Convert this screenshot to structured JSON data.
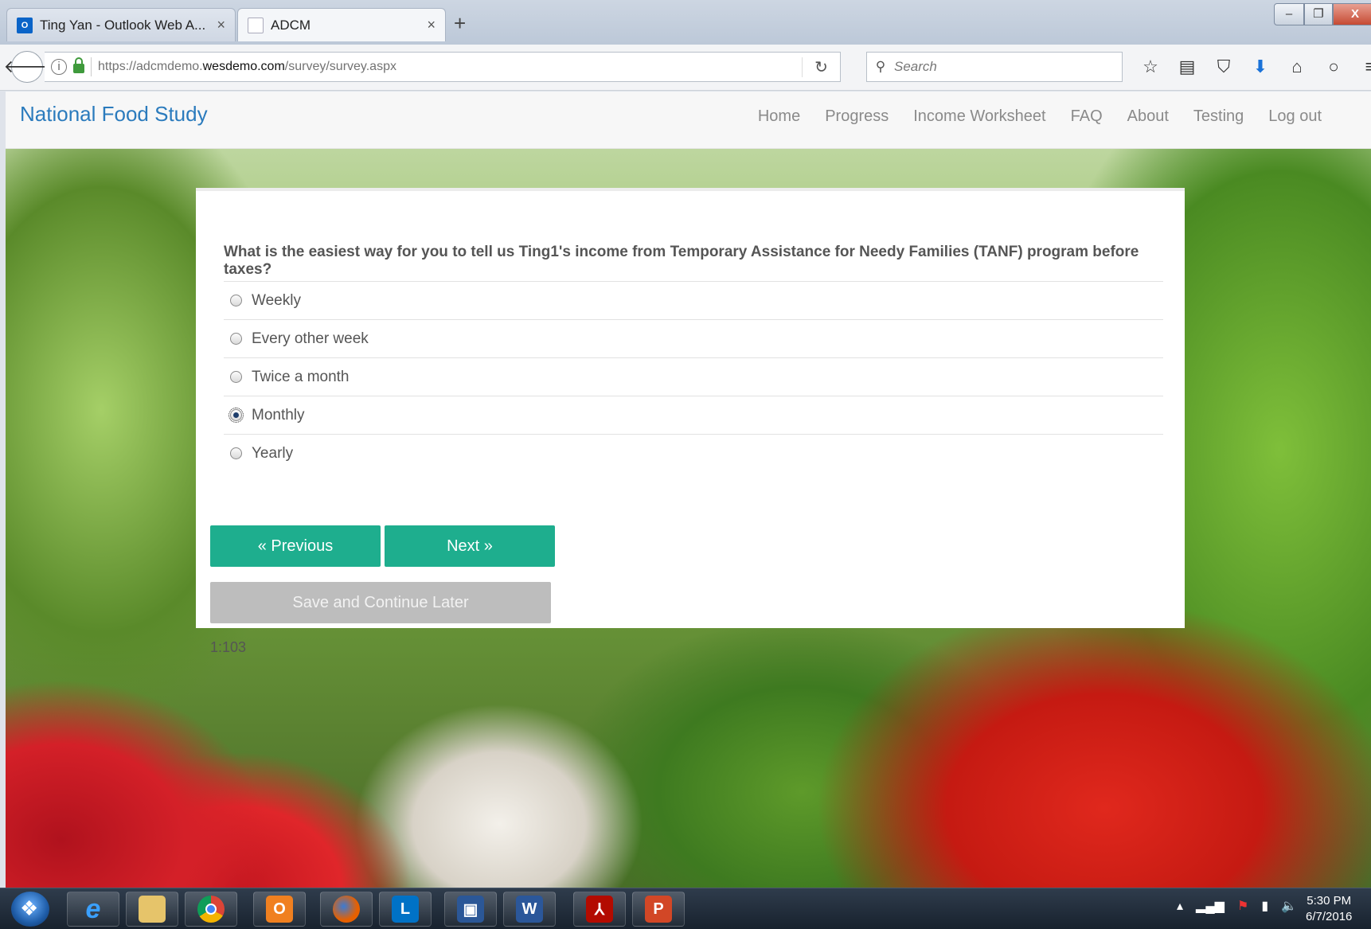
{
  "browser": {
    "tabs": [
      {
        "title": "Ting Yan - Outlook Web A...",
        "icon": "outlook-icon",
        "active": false
      },
      {
        "title": "ADCM",
        "icon": "page-icon",
        "active": true
      }
    ],
    "new_tab": "+",
    "tab_close": "×",
    "window_controls": {
      "minimize": "–",
      "maximize": "❐",
      "close": "X"
    },
    "url_prefix": "https://adcmdemo.",
    "url_domain": "wesdemo.com",
    "url_path": "/survey/survey.aspx",
    "search_placeholder": "Search",
    "toolbar_icons": [
      "bookmark-star-icon",
      "reading-list-icon",
      "pocket-icon",
      "download-icon",
      "home-icon",
      "chat-icon",
      "menu-icon"
    ]
  },
  "site": {
    "brand": "National Food Study",
    "menu": [
      "Home",
      "Progress",
      "Income Worksheet",
      "FAQ",
      "About",
      "Testing",
      "Log out"
    ]
  },
  "survey": {
    "question": "What is the easiest way for you to tell us Ting1's income from Temporary Assistance for Needy Families (TANF) program before taxes?",
    "options": [
      "Weekly",
      "Every other week",
      "Twice a month",
      "Monthly",
      "Yearly"
    ],
    "selected": "Monthly",
    "prev_label": "« Previous",
    "next_label": "Next »",
    "save_label": "Save and Continue Later",
    "code": "1:103"
  },
  "taskbar": {
    "apps": [
      "internet-explorer",
      "file-explorer",
      "chrome",
      "outlook",
      "firefox",
      "lync",
      "remote-desktop",
      "word",
      "acrobat",
      "powerpoint"
    ],
    "time": "5:30 PM",
    "date": "6/7/2016"
  },
  "colors": {
    "brand": "#2b7bbd",
    "primary_button": "#1eae8e",
    "disabled_button": "#bdbdbd"
  }
}
